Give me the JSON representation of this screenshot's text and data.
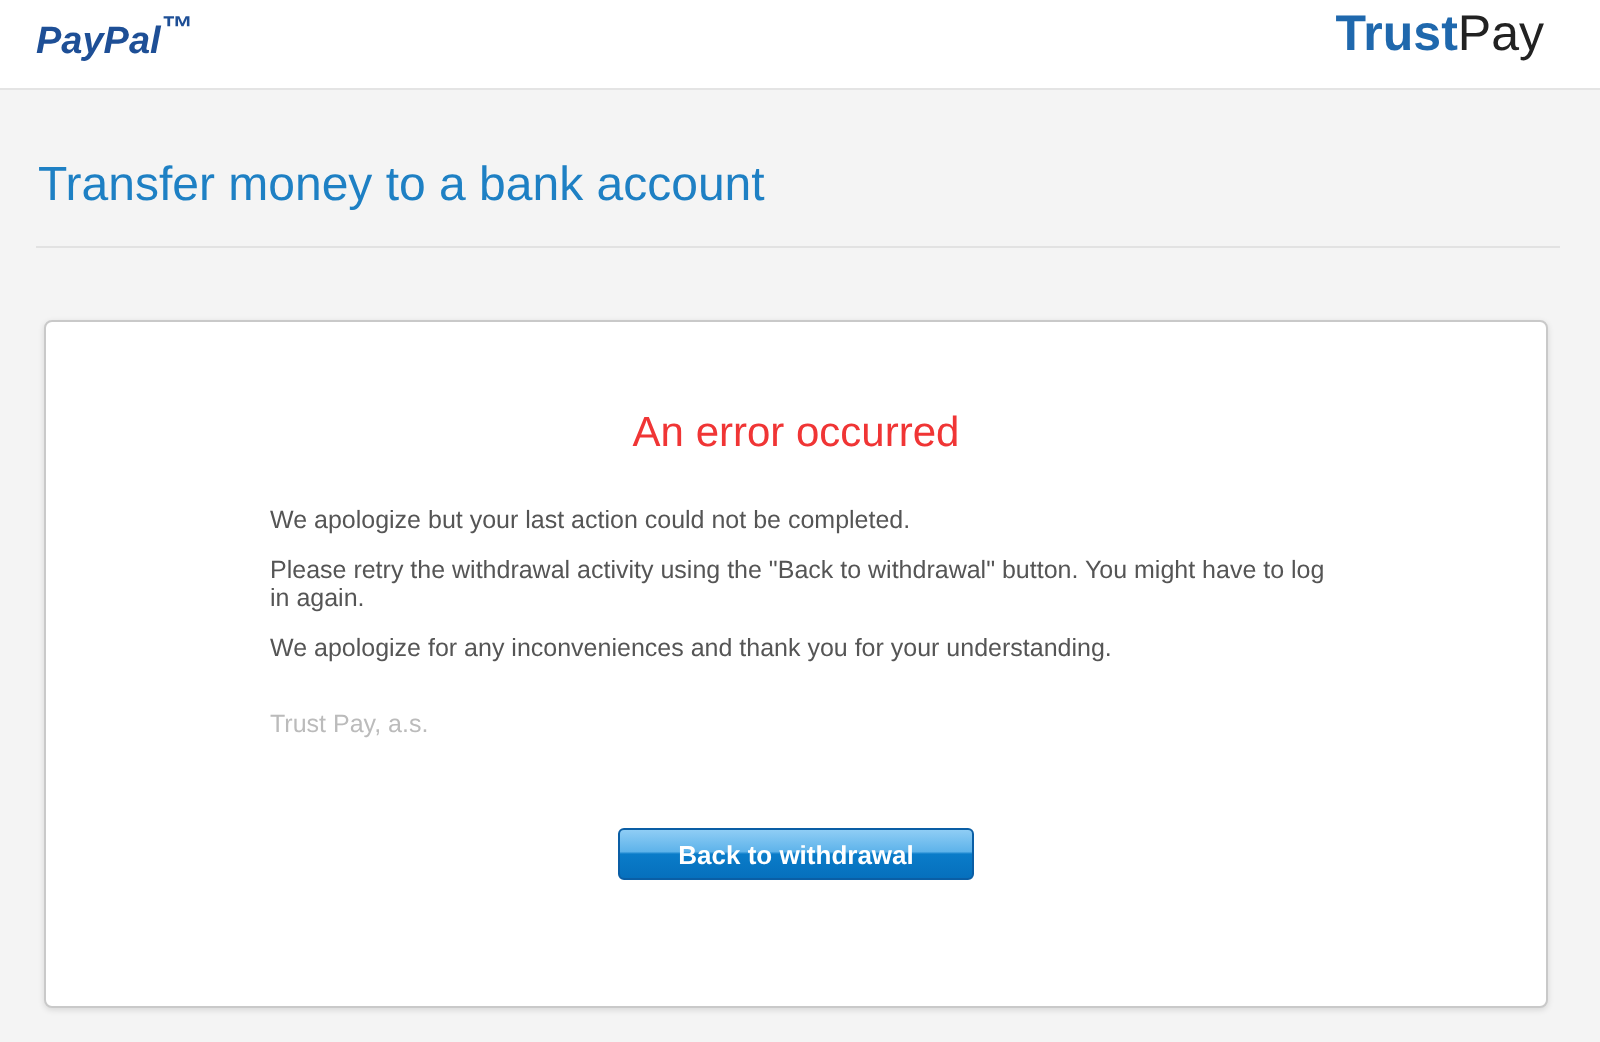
{
  "header": {
    "left_logo": "PayPal$^{™}$",
    "right_logo": {
      "bold": "Trust",
      "regular": "Pay"
    }
  },
  "page_title": "Transfer money to a bank account",
  "card": {
    "title": "An error occurred",
    "paragraphs": [
      "We apologize but your last action could not be completed.",
      "Please retry the withdrawal activity using the \"Back to withdrawal\" button. You might have to log in again.",
      "We apologize for any inconveniences and thank you for your understanding."
    ],
    "signature": "Trust Pay, a.s.",
    "button": "Back to withdrawal"
  }
}
